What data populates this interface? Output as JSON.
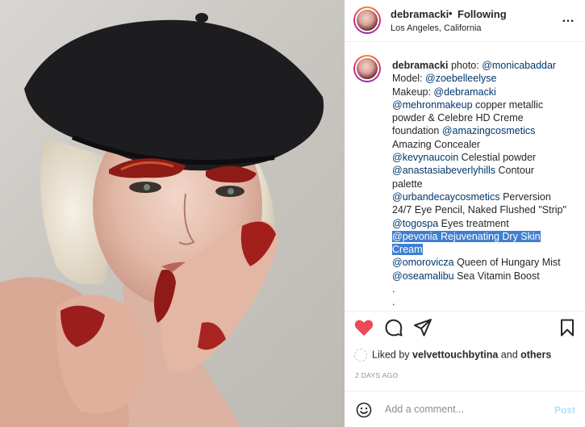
{
  "header": {
    "username": "debramacki",
    "separator": "•",
    "follow_status": "Following",
    "location": "Los Angeles, California",
    "more_icon": "…"
  },
  "caption": {
    "username": "debramacki",
    "lines": [
      [
        {
          "t": " photo: ",
          "k": "text"
        },
        {
          "t": "@monicabaddar",
          "k": "mention"
        }
      ],
      [
        {
          "t": "Model: ",
          "k": "text"
        },
        {
          "t": "@zoebelleelyse",
          "k": "mention"
        }
      ],
      [
        {
          "t": "Makeup: ",
          "k": "text"
        },
        {
          "t": "@debramacki",
          "k": "mention"
        }
      ],
      [
        {
          "t": "@mehronmakeup",
          "k": "mention"
        },
        {
          "t": " copper metallic",
          "k": "text"
        }
      ],
      [
        {
          "t": "powder & Celebre HD Creme",
          "k": "text"
        }
      ],
      [
        {
          "t": "foundation ",
          "k": "text"
        },
        {
          "t": "@amazingcosmetics",
          "k": "mention"
        }
      ],
      [
        {
          "t": "Amazing Concealer",
          "k": "text"
        }
      ],
      [
        {
          "t": "@kevynaucoin",
          "k": "mention"
        },
        {
          "t": " Celestial powder",
          "k": "text"
        }
      ],
      [
        {
          "t": "@anastasiabeverlyhills",
          "k": "mention"
        },
        {
          "t": " Contour",
          "k": "text"
        }
      ],
      [
        {
          "t": "palette",
          "k": "text"
        }
      ],
      [
        {
          "t": "@urbandecaycosmetics",
          "k": "mention"
        },
        {
          "t": " Perversion",
          "k": "text"
        }
      ],
      [
        {
          "t": "24/7 Eye Pencil, Naked Flushed \"Strip\"",
          "k": "text"
        }
      ],
      [
        {
          "t": "@togospa",
          "k": "mention"
        },
        {
          "t": " Eyes treatment",
          "k": "text"
        }
      ],
      [
        {
          "t": "@pevonia Rejuvenating Dry Skin",
          "k": "highlight"
        }
      ],
      [
        {
          "t": "Cream",
          "k": "highlight"
        }
      ],
      [
        {
          "t": "@omorovicza",
          "k": "mention"
        },
        {
          "t": " Queen of Hungary Mist",
          "k": "text"
        }
      ],
      [
        {
          "t": "@oseamalibu",
          "k": "mention"
        },
        {
          "t": " Sea Vitamin Boost",
          "k": "text"
        }
      ],
      [
        {
          "t": ".",
          "k": "text"
        }
      ],
      [
        {
          "t": ".",
          "k": "text"
        }
      ]
    ]
  },
  "actions": {
    "like_icon": "heart-filled-icon",
    "comment_icon": "comment-icon",
    "share_icon": "paper-plane-icon",
    "save_icon": "bookmark-icon",
    "like_color": "#ed4956"
  },
  "likes": {
    "prefix": "Liked by ",
    "user": "velvettouchbytina",
    "middle": " and ",
    "others": "others"
  },
  "timestamp": "2 DAYS AGO",
  "comment_box": {
    "placeholder": "Add a comment...",
    "post_label": "Post"
  }
}
